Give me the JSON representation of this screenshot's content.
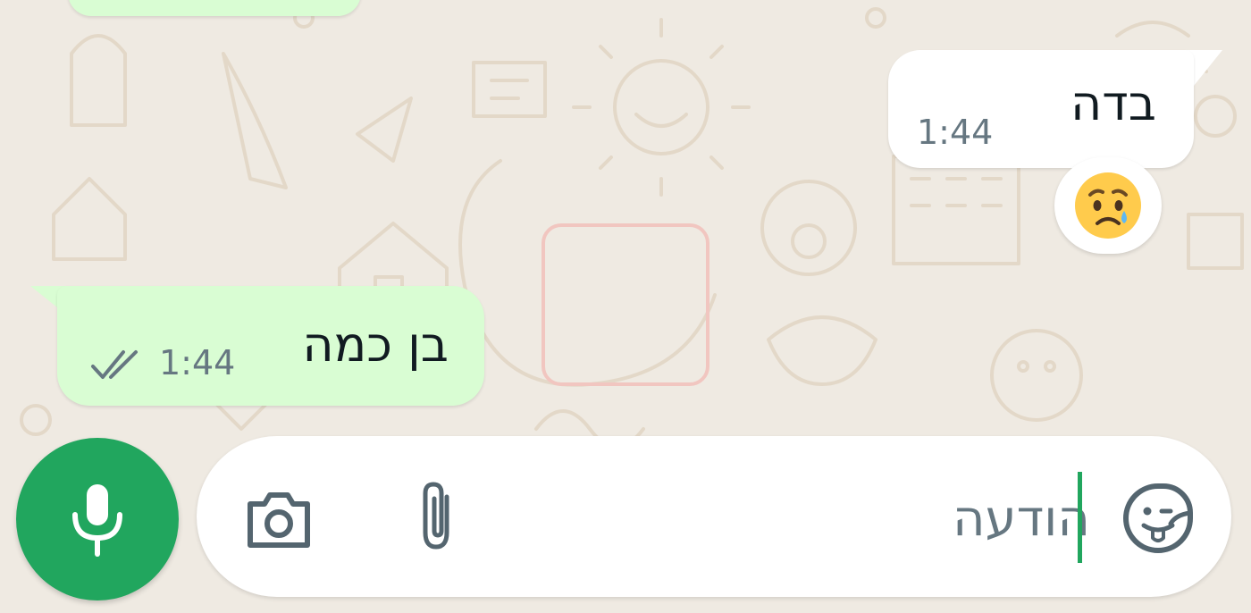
{
  "chat": {
    "messages": [
      {
        "direction": "incoming",
        "text": "בדה",
        "time": "1:44",
        "reaction": "crying-face"
      },
      {
        "direction": "outgoing",
        "text": "בן כמה",
        "time": "1:44",
        "status": "read"
      }
    ]
  },
  "composer": {
    "placeholder": "הודעה",
    "icons": {
      "camera": "camera-icon",
      "attach": "paperclip-icon",
      "sticker": "sticker-icon",
      "voice": "microphone-icon"
    }
  },
  "colors": {
    "wallpaper": "#efeae2",
    "outgoing_bubble": "#d9fdd3",
    "incoming_bubble": "#ffffff",
    "accent": "#21a65e",
    "icon": "#54656f",
    "meta_text": "#667781"
  }
}
